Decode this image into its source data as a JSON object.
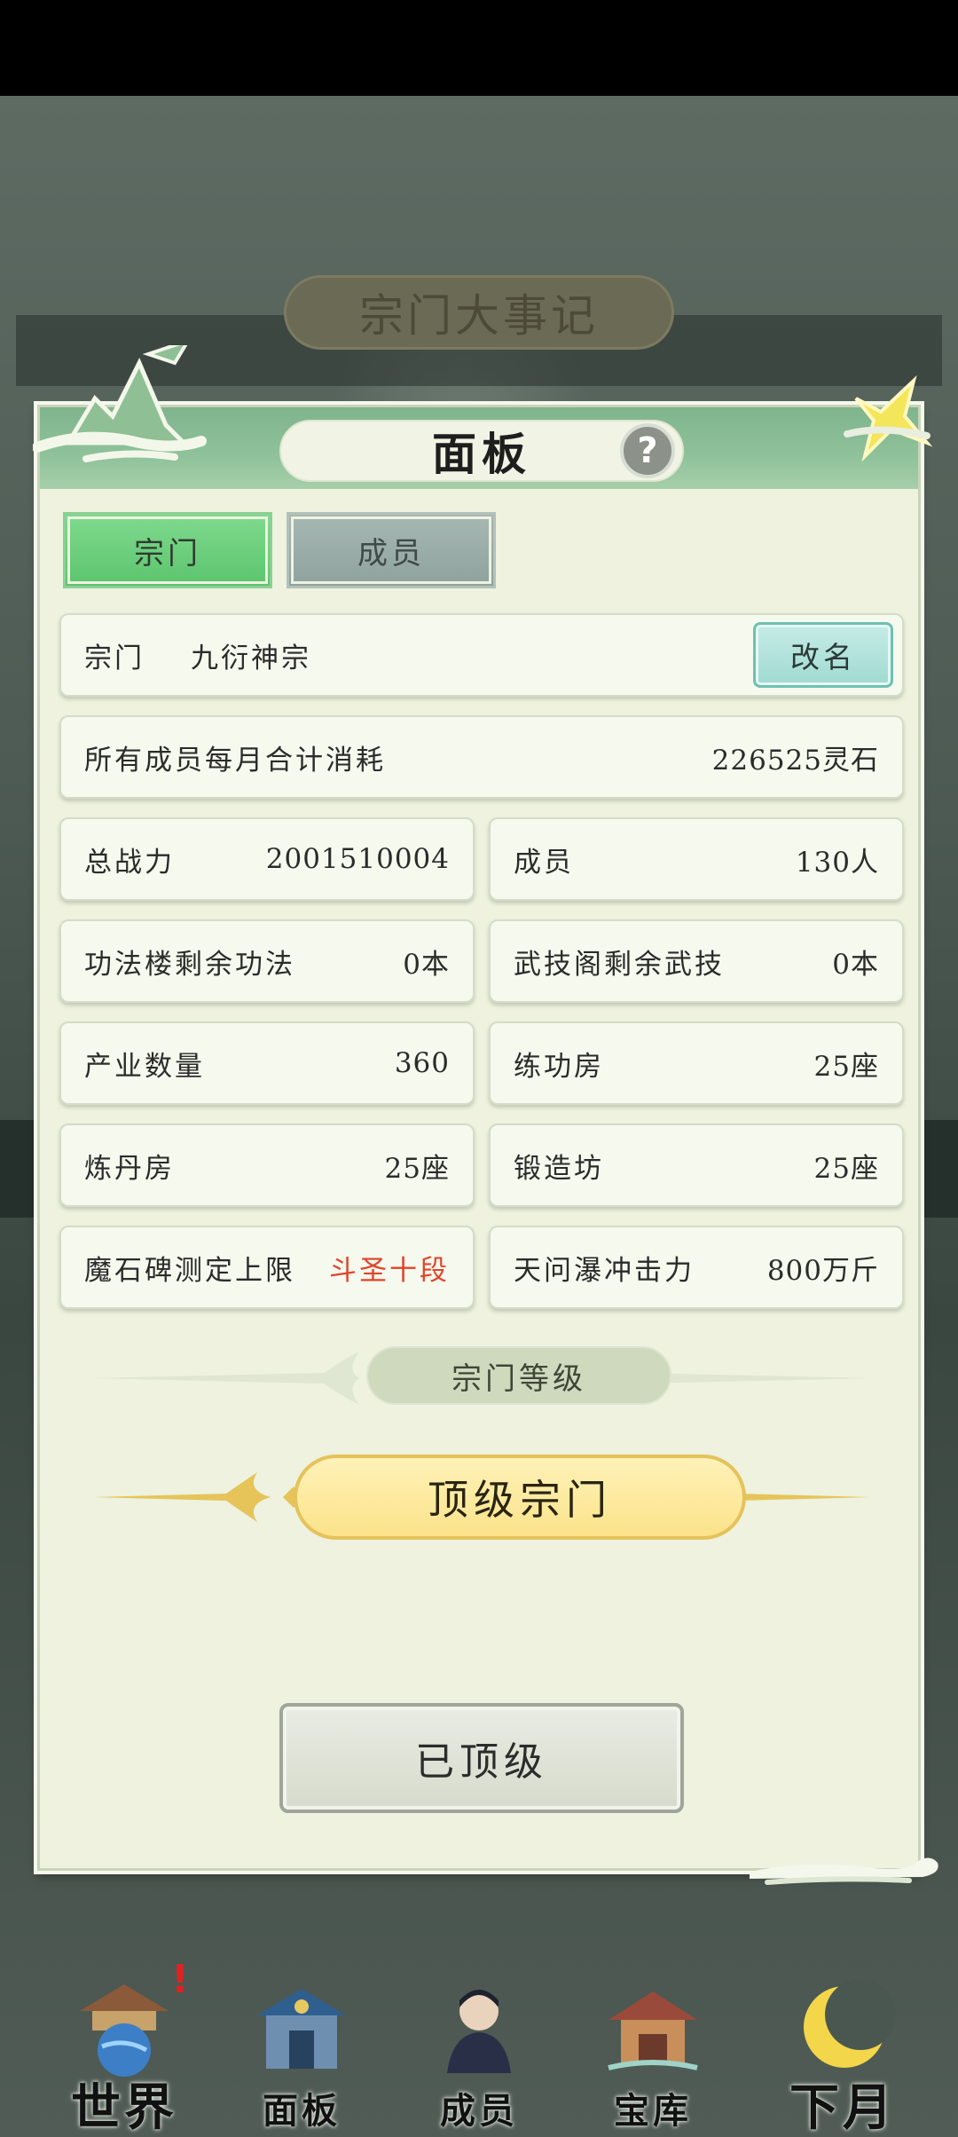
{
  "background": {
    "banner_title": "宗门大事记"
  },
  "modal": {
    "title": "面板",
    "help_icon": "?",
    "tabs": [
      {
        "label": "宗门",
        "active": true
      },
      {
        "label": "成员",
        "active": false
      }
    ],
    "sect": {
      "label": "宗门",
      "name": "九衍神宗",
      "rename_label": "改名"
    },
    "consumption": {
      "label": "所有成员每月合计消耗",
      "value": "226525灵石"
    },
    "stats": [
      {
        "label": "总战力",
        "value": "2001510004"
      },
      {
        "label": "成员",
        "value": "130人"
      },
      {
        "label": "功法楼剩余功法",
        "value": "0本"
      },
      {
        "label": "武技阁剩余武技",
        "value": "0本"
      },
      {
        "label": "产业数量",
        "value": "360"
      },
      {
        "label": "练功房",
        "value": "25座"
      },
      {
        "label": "炼丹房",
        "value": "25座"
      },
      {
        "label": "锻造坊",
        "value": "25座"
      },
      {
        "label": "魔石碑测定上限",
        "value": "斗圣十段"
      },
      {
        "label": "天问瀑冲击力",
        "value": "800万斤"
      }
    ],
    "level_section_title": "宗门等级",
    "level_value": "顶级宗门",
    "maxed_button_label": "已顶级"
  },
  "bottom_nav": [
    {
      "label": "世界",
      "icon": "palace-globe-icon"
    },
    {
      "label": "面板",
      "icon": "gate-icon"
    },
    {
      "label": "成员",
      "icon": "disciple-icon"
    },
    {
      "label": "宝库",
      "icon": "treasure-pavilion-icon"
    },
    {
      "label": "下月",
      "icon": "crescent-moon-icon"
    }
  ],
  "colors": {
    "modal_bg": "#eef2df",
    "header_green": "#8fc29a",
    "active_tab": "#5cc46d",
    "highlight_red": "#e0442a",
    "gold": "#fbe38a"
  }
}
